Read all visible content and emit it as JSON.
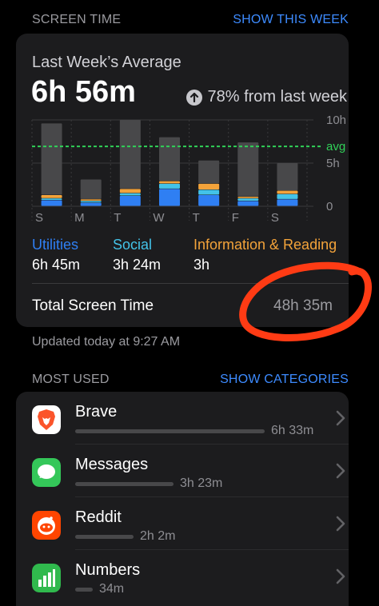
{
  "screen_time_header": {
    "title": "SCREEN TIME",
    "action": "SHOW THIS WEEK"
  },
  "summary": {
    "label": "Last Week’s Average",
    "value": "6h 56m",
    "trend": "78% from last week",
    "total_label": "Total Screen Time",
    "total_value": "48h 35m"
  },
  "colors": {
    "utilities": "#2f7ff3",
    "social": "#43c3e8",
    "information": "#f3a33a",
    "bar_base": "#48484a",
    "avg_line": "#30d158",
    "annotation": "#ff3b14"
  },
  "chart_data": {
    "type": "bar",
    "categories": [
      "S",
      "M",
      "T",
      "W",
      "T",
      "F",
      "S"
    ],
    "y_ticks": [
      "10h",
      "5h",
      "0"
    ],
    "ylim": [
      0,
      10
    ],
    "avg_label": "avg",
    "avg_value": 6.93,
    "series": [
      {
        "name": "Utilities",
        "values": [
          0.7,
          0.4,
          1.2,
          2.0,
          1.3,
          0.6,
          0.8
        ]
      },
      {
        "name": "Social",
        "values": [
          0.2,
          0.2,
          0.3,
          0.6,
          0.6,
          0.3,
          0.6
        ]
      },
      {
        "name": "Information & Reading",
        "values": [
          0.4,
          0.2,
          0.5,
          0.3,
          0.7,
          0.2,
          0.4
        ]
      },
      {
        "name": "Other",
        "values": [
          8.3,
          2.3,
          8.0,
          5.1,
          2.7,
          6.3,
          3.2
        ]
      }
    ]
  },
  "legend": [
    {
      "name": "Utilities",
      "value": "6h 45m"
    },
    {
      "name": "Social",
      "value": "3h 24m"
    },
    {
      "name": "Information & Reading",
      "value": "3h"
    }
  ],
  "updated": "Updated today at 9:27 AM",
  "most_used_header": {
    "title": "MOST USED",
    "action": "SHOW CATEGORIES"
  },
  "apps": [
    {
      "name": "Brave",
      "time": "6h 33m",
      "usage": 1.0,
      "icon": "brave-lion-icon"
    },
    {
      "name": "Messages",
      "time": "3h 23m",
      "usage": 0.52,
      "icon": "messages-bubble-icon"
    },
    {
      "name": "Reddit",
      "time": "2h 2m",
      "usage": 0.31,
      "icon": "reddit-alien-icon"
    },
    {
      "name": "Numbers",
      "time": "34m",
      "usage": 0.09,
      "icon": "numbers-chart-icon"
    }
  ]
}
